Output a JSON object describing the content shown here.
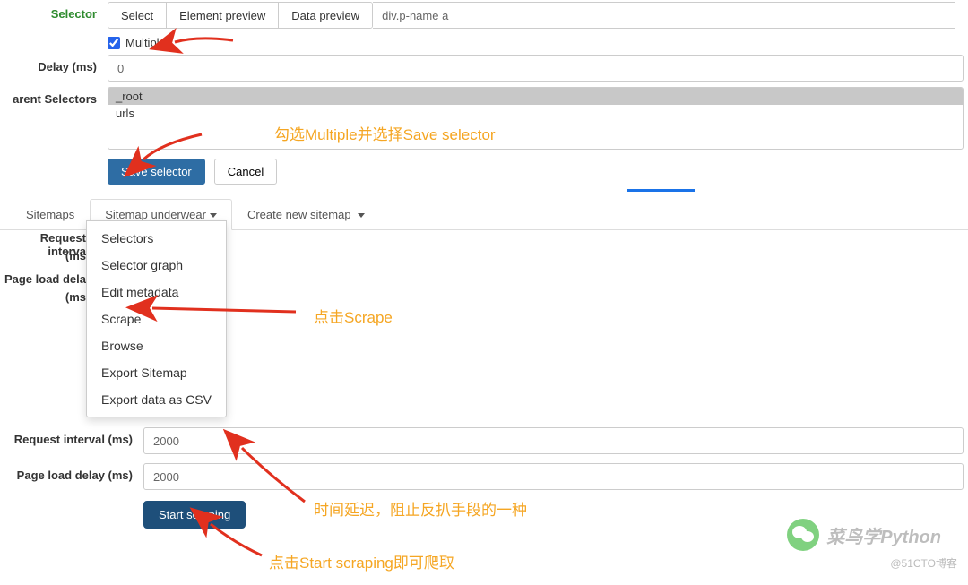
{
  "top": {
    "selector_label": "Selector",
    "tabs": {
      "select": "Select",
      "element_preview": "Element preview",
      "data_preview": "Data preview"
    },
    "selector_value": "div.p-name a",
    "multiple_label": "Multiple",
    "delay_label": "Delay (ms)",
    "delay_value": "0",
    "parent_label": "arent Selectors",
    "parent_options": {
      "root": "_root",
      "urls": "urls"
    },
    "save_btn": "Save selector",
    "cancel_btn": "Cancel"
  },
  "nav": {
    "sitemaps": "Sitemaps",
    "sitemap_current": "Sitemap underwear",
    "create_new": "Create new sitemap"
  },
  "dropdown": {
    "selectors": "Selectors",
    "selector_graph": "Selector graph",
    "edit_metadata": "Edit metadata",
    "scrape": "Scrape",
    "browse": "Browse",
    "export_sitemap": "Export Sitemap",
    "export_csv": "Export data as CSV"
  },
  "panel_labels": {
    "request_interval": "Request interval (ms)",
    "page_load_delay": "Page load delay (ms)"
  },
  "bottom": {
    "request_interval_label": "Request interval (ms)",
    "request_interval_value": "2000",
    "page_load_delay_label": "Page load delay (ms)",
    "page_load_delay_value": "2000",
    "start_btn": "Start scraping"
  },
  "annotations": {
    "a1": "勾选Multiple并选择Save selector",
    "a2": "点击Scrape",
    "a3": "时间延迟，阻止反扒手段的一种",
    "a4": "点击Start scraping即可爬取"
  },
  "watermark": {
    "name": "菜鸟学Python",
    "site": "@51CTO博客"
  }
}
